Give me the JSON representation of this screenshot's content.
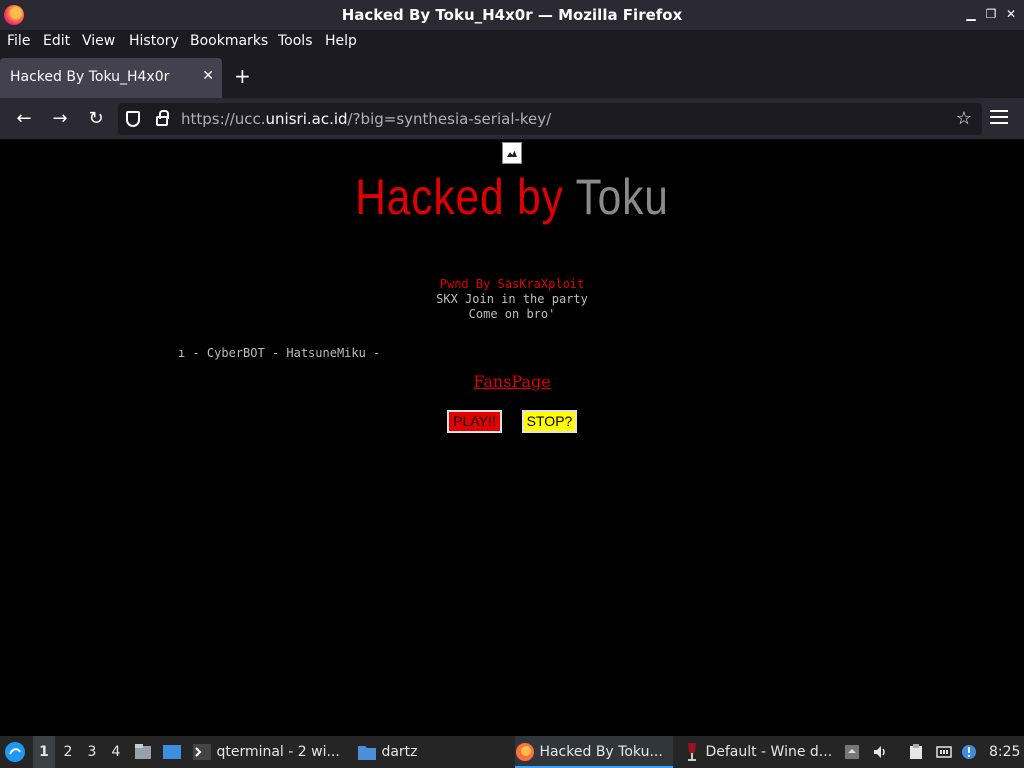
{
  "window": {
    "title": "Hacked By Toku_H4x0r — Mozilla Firefox"
  },
  "menu": {
    "items": [
      "File",
      "Edit",
      "View",
      "History",
      "Bookmarks",
      "Tools",
      "Help"
    ]
  },
  "tabs": [
    {
      "label": "Hacked By Toku_H4x0r",
      "active": true
    }
  ],
  "nav": {
    "url_prefix": "https://ucc.",
    "url_host": "unisri.ac.id",
    "url_path": "/?big=synthesia-serial-key/"
  },
  "page": {
    "headline_red": "Hacked by",
    "headline_grey": "Toku",
    "pwnd": "Pwnd By SasKraXploit",
    "skx": "SKX Join in the party",
    "come": "Come on bro'",
    "marquee": "ı - CyberBOT - HatsuneMiku -",
    "fanspage": "FansPage",
    "play_label": "PLAY!!",
    "stop_label": "STOP?"
  },
  "taskbar": {
    "workspaces": [
      "1",
      "2",
      "3",
      "4"
    ],
    "active_workspace": "1",
    "tasks": [
      {
        "label": "qterminal - 2 wi...",
        "icon": "terminal-icon"
      },
      {
        "label": "dartz",
        "icon": "folder-icon"
      },
      {
        "label": "Hacked By Toku...",
        "icon": "firefox-icon",
        "active": true
      },
      {
        "label": "Default - Wine d...",
        "icon": "wine-icon"
      }
    ],
    "clock": "8:25"
  },
  "colors": {
    "accent_red": "#e00000",
    "stop_yellow": "#ffff00",
    "chrome_dark": "#2b2a33"
  }
}
